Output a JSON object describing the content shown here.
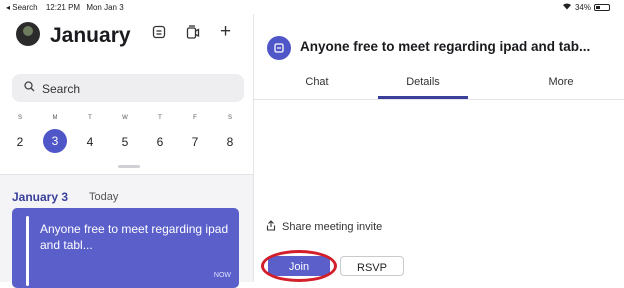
{
  "status_bar": {
    "back_app": "◂ Search",
    "time": "12:21 PM",
    "date": "Mon Jan 3",
    "wifi_icon": "wifi-icon",
    "battery": "34%",
    "battery_level": 0.34
  },
  "sidebar": {
    "month": "January",
    "search_placeholder": "Search",
    "week": {
      "days_of_week": [
        "S",
        "M",
        "T",
        "W",
        "T",
        "F",
        "S"
      ],
      "dates": [
        "2",
        "3",
        "4",
        "5",
        "6",
        "7",
        "8"
      ],
      "selected_index": 1
    },
    "agenda": {
      "date_label": "January 3",
      "today_label": "Today",
      "event_title": "Anyone free to meet regarding ipad and tabl...",
      "event_status": "NOW"
    }
  },
  "detail": {
    "title": "Anyone free to meet regarding ipad and tab...",
    "tabs": [
      "Chat",
      "Details",
      "More"
    ],
    "active_tab": "Details",
    "share_label": "Share meeting invite",
    "join_label": "Join",
    "rsvp_label": "RSVP"
  },
  "colors": {
    "accent": "#4f56c8",
    "event_bg": "#5a5fca",
    "highlight": "#d21f2a"
  }
}
